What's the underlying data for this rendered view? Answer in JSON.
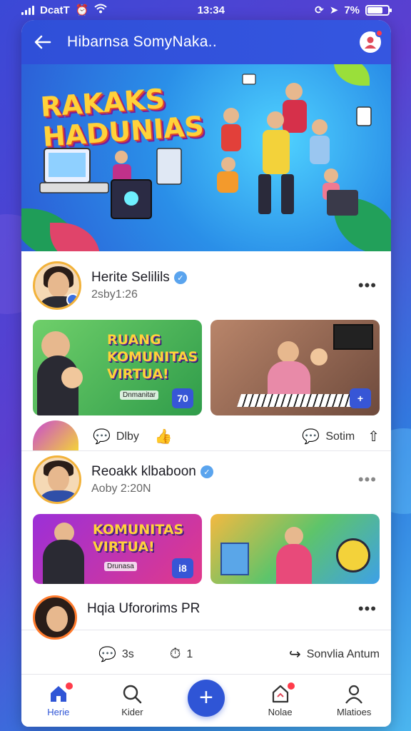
{
  "status_bar": {
    "carrier": "DcatT",
    "time": "13:34",
    "battery": "7%",
    "battery_level": 0.75
  },
  "header": {
    "title": "Hibarnsa SomyNaka.."
  },
  "hero": {
    "title": "RAKAKS HADUNIAS"
  },
  "posts": [
    {
      "name": "Herite Selilils",
      "time": "2sby1:26",
      "cards": [
        {
          "text": "RUANG KOMUNITAS VIRTUA!",
          "sub": "Dnmanitar",
          "badge": "70"
        },
        {
          "text": "",
          "sub": "",
          "badge": "+"
        }
      ],
      "actions": {
        "like": "Dlby",
        "comment": "Sotim"
      }
    },
    {
      "name": "Reoakk klbaboon",
      "time": "Aoby 2:20N",
      "cards": [
        {
          "text": "KOMUNITAS VIRTUA!",
          "sub": "Drunasa",
          "badge": "i8"
        },
        {
          "text": "",
          "sub": "",
          "badge": ""
        }
      ]
    },
    {
      "name": "Hqia Ufororims PR",
      "actions": {
        "comments": "3s",
        "likes": "1",
        "share": "Sonvlia Antum"
      }
    }
  ],
  "bottom_nav": [
    {
      "label": "Herie",
      "icon": "home-icon",
      "active": true,
      "badge": true
    },
    {
      "label": "Kider",
      "icon": "search-icon",
      "active": false,
      "badge": false
    },
    {
      "label": "",
      "icon": "plus-icon",
      "active": false,
      "badge": false
    },
    {
      "label": "Nolae",
      "icon": "notification-icon",
      "active": false,
      "badge": true
    },
    {
      "label": "Mlatioes",
      "icon": "profile-icon",
      "active": false,
      "badge": false
    }
  ],
  "colors": {
    "accent": "#2f55d6",
    "header": "#3556e0",
    "badge": "#ff3b4a"
  }
}
